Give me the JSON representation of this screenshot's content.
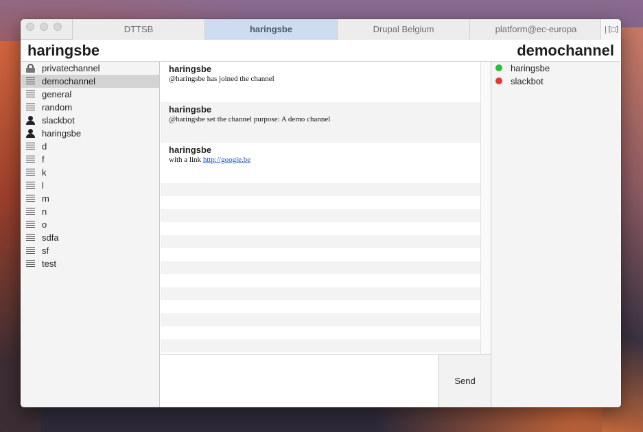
{
  "tabs": [
    {
      "label": "DTTSB",
      "active": false
    },
    {
      "label": "haringsbe",
      "active": true
    },
    {
      "label": "Drupal Belgium",
      "active": false
    },
    {
      "label": "platform@ec-europa",
      "active": false
    }
  ],
  "header": {
    "team_name": "haringsbe",
    "channel_name": "demochannel"
  },
  "sidebar": {
    "items": [
      {
        "label": "privatechannel",
        "icon": "lock-icon"
      },
      {
        "label": "demochannel",
        "icon": "channel-lines-icon",
        "selected": true
      },
      {
        "label": "general",
        "icon": "channel-lines-icon"
      },
      {
        "label": "random",
        "icon": "channel-lines-icon"
      },
      {
        "label": "slackbot",
        "icon": "user-icon"
      },
      {
        "label": "haringsbe",
        "icon": "user-icon"
      },
      {
        "label": "d",
        "icon": "channel-lines-icon"
      },
      {
        "label": "f",
        "icon": "channel-lines-icon"
      },
      {
        "label": "k",
        "icon": "channel-lines-icon"
      },
      {
        "label": "l",
        "icon": "channel-lines-icon"
      },
      {
        "label": "m",
        "icon": "channel-lines-icon"
      },
      {
        "label": "n",
        "icon": "channel-lines-icon"
      },
      {
        "label": "o",
        "icon": "channel-lines-icon"
      },
      {
        "label": "sdfa",
        "icon": "channel-lines-icon"
      },
      {
        "label": "sf",
        "icon": "channel-lines-icon"
      },
      {
        "label": "test",
        "icon": "channel-lines-icon"
      }
    ]
  },
  "messages": [
    {
      "author": "haringsbe",
      "text": "@haringsbe has joined the channel"
    },
    {
      "author": "haringsbe",
      "text": "@haringsbe set the channel purpose: A demo channel"
    },
    {
      "author": "haringsbe",
      "text_prefix": "with a link ",
      "link": "http://google.be"
    }
  ],
  "composer": {
    "input_value": "",
    "send_label": "Send"
  },
  "users": [
    {
      "name": "haringsbe",
      "status": "online",
      "color": "#2bbd3a"
    },
    {
      "name": "slackbot",
      "status": "offline",
      "color": "#e53935"
    }
  ],
  "colors": {
    "active_tab": "#cddcf1",
    "selected_item": "#d3d3d3",
    "online": "#2bbd3a",
    "offline": "#e53935",
    "link": "#1a4fc4"
  }
}
